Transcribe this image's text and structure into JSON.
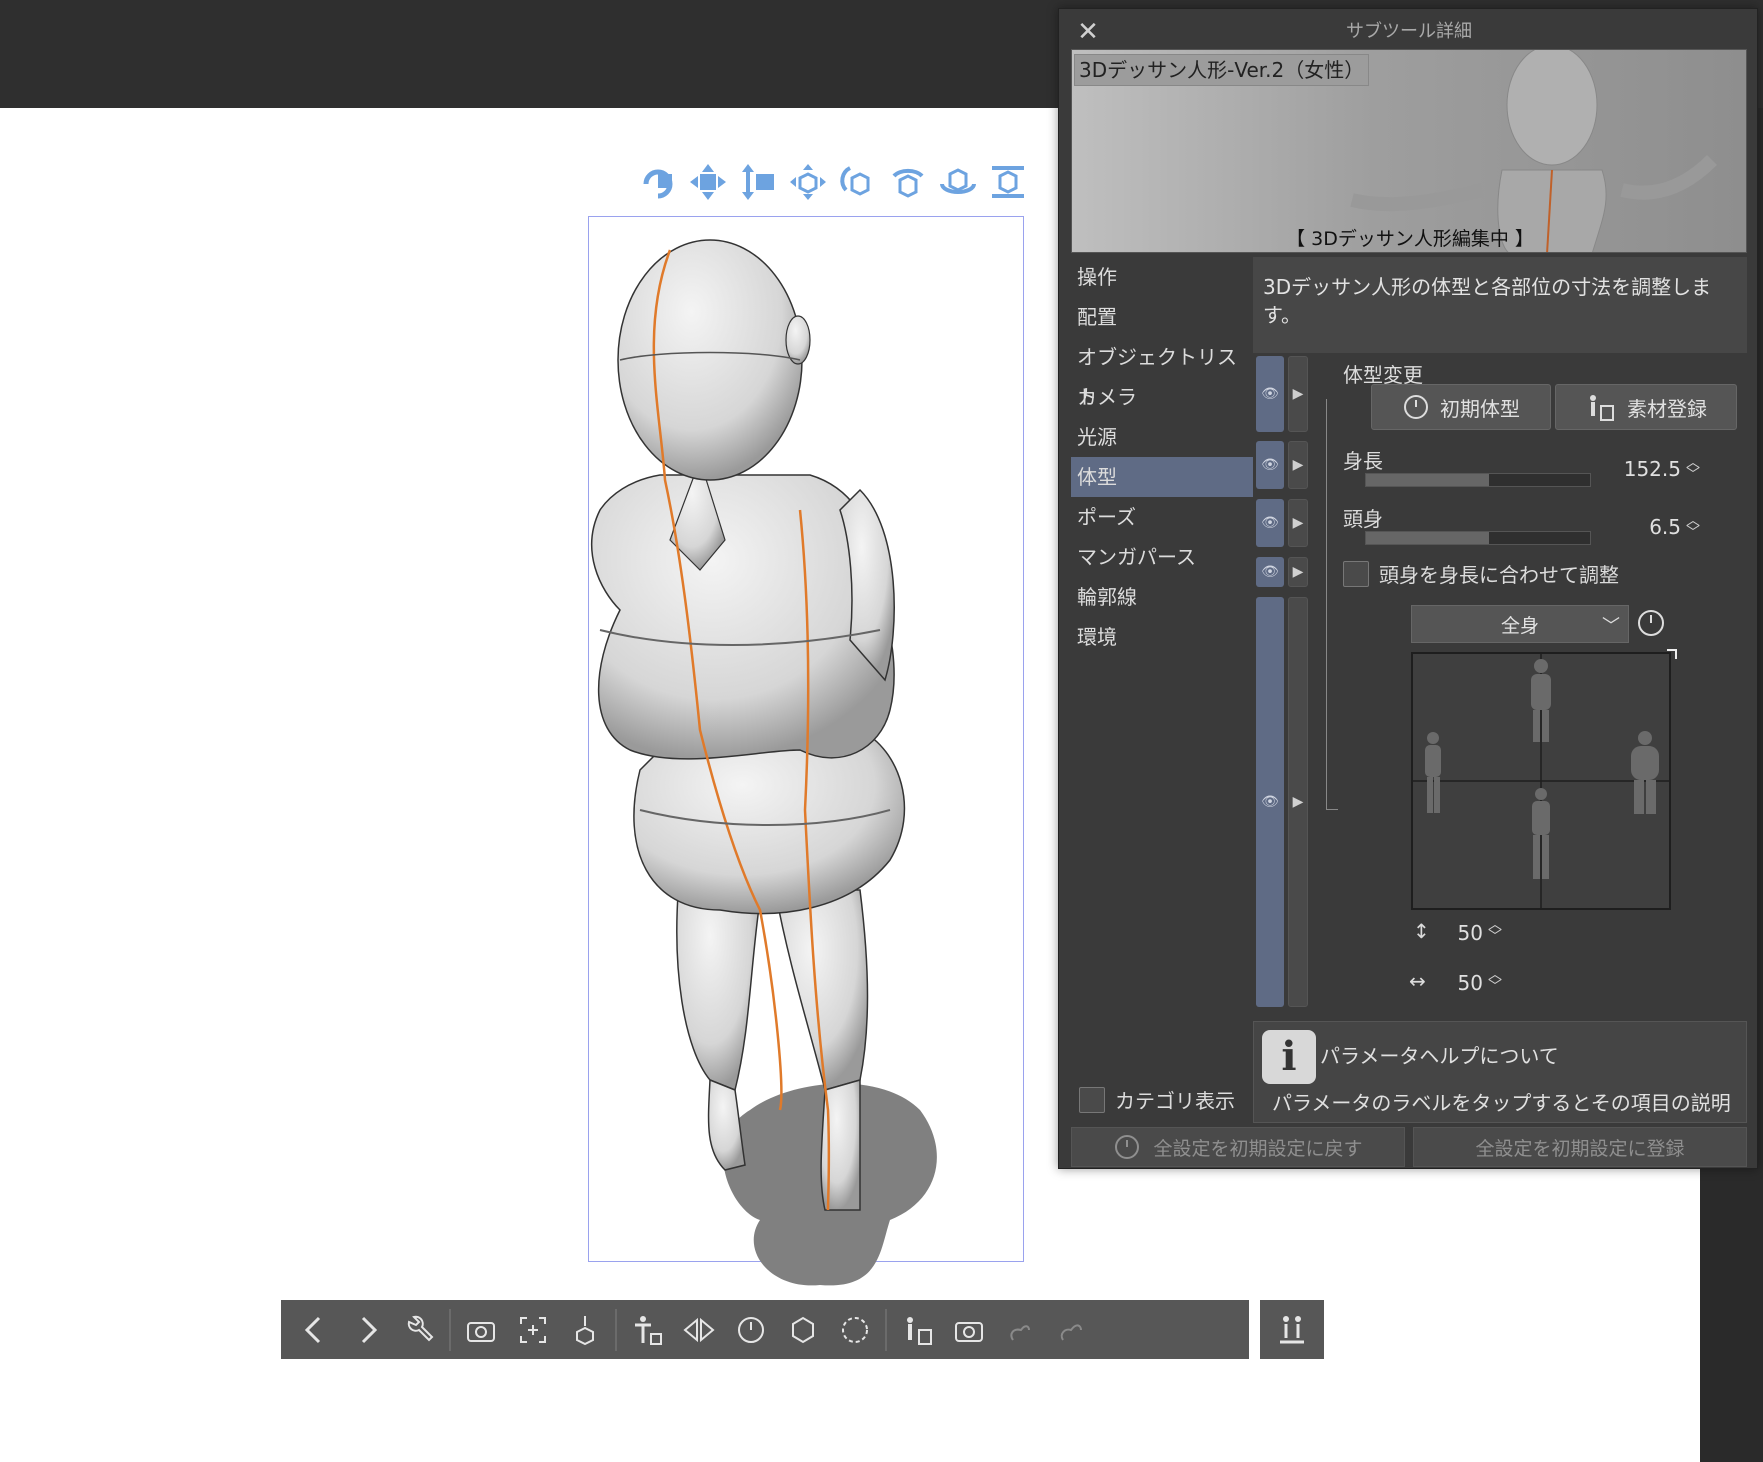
{
  "panel": {
    "title": "サブツール詳細",
    "close_icon": "close-icon",
    "preview": {
      "name": "3Dデッサン人形-Ver.2（女性）",
      "caption": "【 3Dデッサン人形編集中 】"
    },
    "categories": [
      {
        "label": "操作",
        "selected": false
      },
      {
        "label": "配置",
        "selected": false
      },
      {
        "label": "オブジェクトリスト",
        "selected": false
      },
      {
        "label": "カメラ",
        "selected": false
      },
      {
        "label": "光源",
        "selected": false
      },
      {
        "label": "体型",
        "selected": true
      },
      {
        "label": "ポーズ",
        "selected": false
      },
      {
        "label": "マンガパース",
        "selected": false
      },
      {
        "label": "輪郭線",
        "selected": false
      },
      {
        "label": "環境",
        "selected": false
      }
    ],
    "category_display_label": "カテゴリ表示",
    "description": "3Dデッサン人形の体型と各部位の寸法を調整します。",
    "body_type": {
      "section_label": "体型変更",
      "reset_button": "初期体型",
      "register_button": "素材登録",
      "height": {
        "label": "身長",
        "value": "152.5",
        "fill": 0.55
      },
      "head_ratio": {
        "label": "頭身",
        "value": "6.5",
        "fill": 0.55
      },
      "adjust_checkbox": "頭身を身長に合わせて調整",
      "part_select": "全身",
      "vertical_value": "50",
      "horizontal_value": "50"
    },
    "help": {
      "title": "パラメータヘルプについて",
      "body": "パラメータのラベルをタップするとその項目の説明が表示されます"
    },
    "footer": {
      "reset_all": "全設定を初期設定に戻す",
      "register_all": "全設定を初期設定に登録"
    }
  },
  "accent_color": "#5f6b85",
  "manipulator_icons": [
    "camera-rotate-icon",
    "camera-pan-icon",
    "camera-dolly-icon",
    "move-icon",
    "rotate-icon",
    "rotate-x-icon",
    "rotate-y-icon",
    "rotate-z-icon"
  ],
  "object_toolbar_icons": [
    "prev-icon",
    "next-icon",
    "wrench-icon",
    "camera-icon",
    "fit-icon",
    "ground-icon",
    "pose-add-icon",
    "flip-icon",
    "reset-icon",
    "object-reset-icon",
    "rotate-reset-icon",
    "pose-register-icon",
    "camera-preset-icon",
    "hand-icon",
    "hand-register-icon",
    "body-switch-icon"
  ]
}
